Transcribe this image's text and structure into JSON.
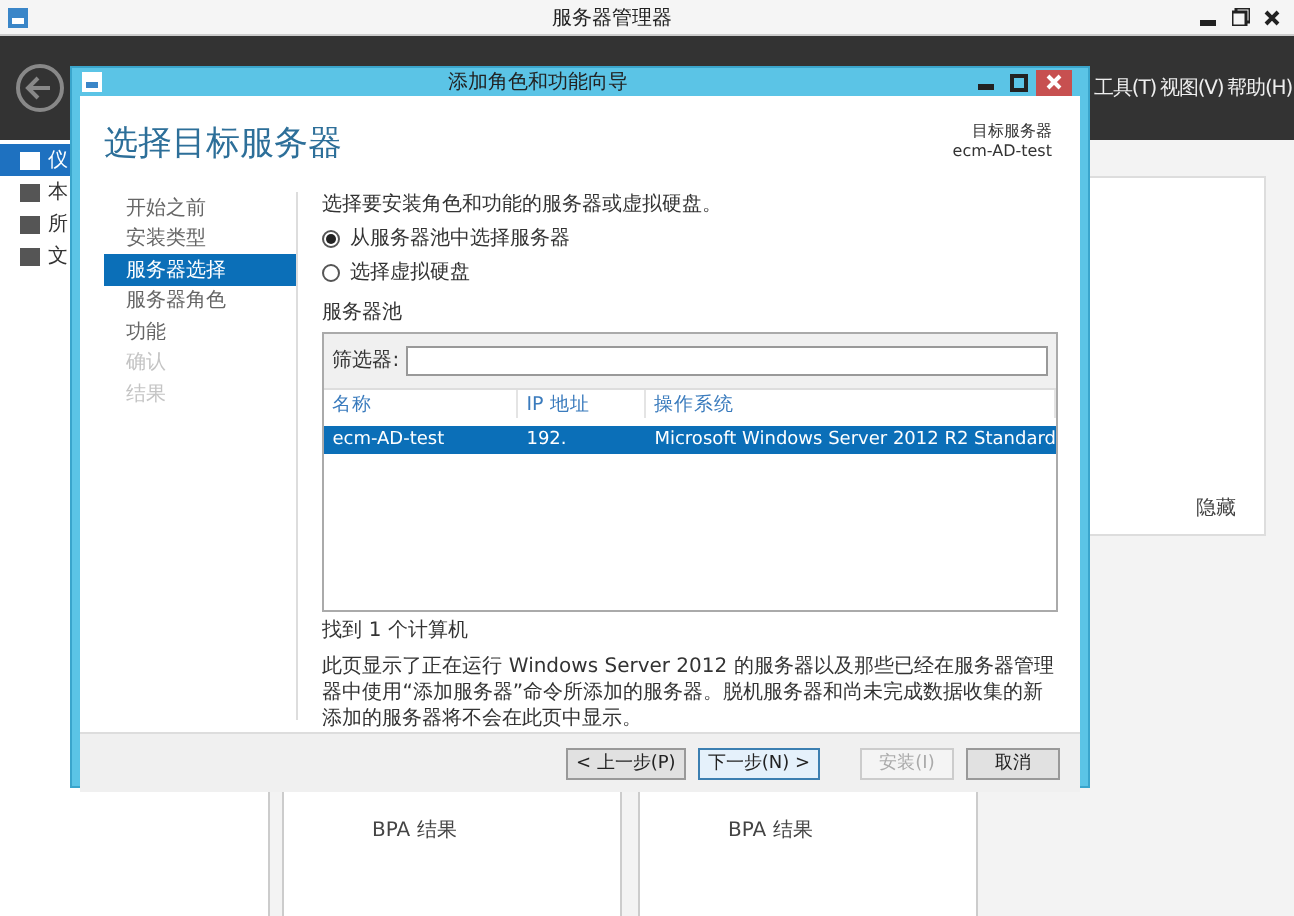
{
  "window": {
    "title": "服务器管理器"
  },
  "header": {
    "menu": [
      "工具(T)",
      "视图(V)",
      "帮助(H)"
    ]
  },
  "sidebar": {
    "items": [
      {
        "label": "仪",
        "selected": true
      },
      {
        "label": "本",
        "selected": false
      },
      {
        "label": "所",
        "selected": false
      },
      {
        "label": "文",
        "selected": false
      }
    ]
  },
  "welcome_panel": {
    "hide_link": "隐藏"
  },
  "tiles": [
    {
      "items": [
        "BPA 结果"
      ]
    },
    {
      "items": [
        "BPA 结果"
      ]
    }
  ],
  "dialog": {
    "title": "添加角色和功能向导",
    "heading": "选择目标服务器",
    "target_label": "目标服务器",
    "target_value": "ecm-AD-test",
    "steps": [
      {
        "label": "开始之前",
        "selected": false,
        "disabled": false
      },
      {
        "label": "安装类型",
        "selected": false,
        "disabled": false
      },
      {
        "label": "服务器选择",
        "selected": true,
        "disabled": false
      },
      {
        "label": "服务器角色",
        "selected": false,
        "disabled": false
      },
      {
        "label": "功能",
        "selected": false,
        "disabled": false
      },
      {
        "label": "确认",
        "selected": false,
        "disabled": true
      },
      {
        "label": "结果",
        "selected": false,
        "disabled": true
      }
    ],
    "description": "选择要安装角色和功能的服务器或虚拟硬盘。",
    "options": [
      {
        "label": "从服务器池中选择服务器",
        "selected": true
      },
      {
        "label": "选择虚拟硬盘",
        "selected": false
      }
    ],
    "pool": {
      "title": "服务器池",
      "filter_label": "筛选器:",
      "columns": [
        "名称",
        "IP 地址",
        "操作系统"
      ],
      "rows": [
        {
          "cells": [
            "ecm-AD-test",
            "192.",
            "Microsoft Windows Server 2012 R2 Standard"
          ],
          "selected": true
        }
      ]
    },
    "found": "找到 1 个计算机",
    "note": "此页显示了正在运行 Windows Server 2012 的服务器以及那些已经在服务器管理器中使用“添加服务器”命令所添加的服务器。脱机服务器和尚未完成数据收集的新添加的服务器将不会在此页中显示。",
    "buttons": [
      {
        "label": "< 上一步(P)",
        "focused": false,
        "disabled": false
      },
      {
        "label": "下一步(N) >",
        "focused": true,
        "disabled": false
      },
      {
        "label": "安装(I)",
        "focused": false,
        "disabled": true
      },
      {
        "label": "取消",
        "focused": false,
        "disabled": false
      }
    ]
  }
}
